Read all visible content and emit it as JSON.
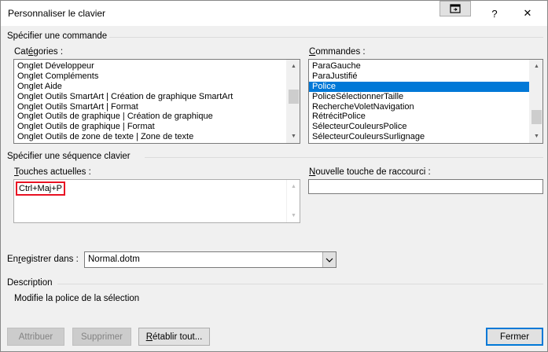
{
  "window": {
    "title": "Personnaliser le clavier",
    "help_symbol": "?",
    "close_symbol": "✕"
  },
  "command_section": {
    "label": "Spécifier une commande",
    "categories": {
      "label_pre": "Cat",
      "label_u": "é",
      "label_post": "gories :",
      "items": [
        "Onglet Développeur",
        "Onglet Compléments",
        "Onglet Aide",
        "Onglet Outils SmartArt | Création de graphique SmartArt",
        "Onglet Outils SmartArt | Format",
        "Onglet Outils de graphique | Création de graphique",
        "Onglet Outils de graphique | Format",
        "Onglet Outils de zone de texte | Zone de texte"
      ]
    },
    "commands": {
      "label_u": "C",
      "label_post": "ommandes :",
      "items": [
        "ParaGauche",
        "ParaJustifié",
        "Police",
        "PoliceSélectionnerTaille",
        "RechercheVoletNavigation",
        "RétrécitPolice",
        "SélecteurCouleursPolice",
        "SélecteurCouleursSurlignage"
      ],
      "selected_index": 2
    }
  },
  "shortcut_section": {
    "label": "Spécifier une séquence clavier",
    "current_keys": {
      "label_u": "T",
      "label_post": "ouches actuelles :",
      "items": [
        "Ctrl+Maj+P"
      ]
    },
    "new_key": {
      "label_u": "N",
      "label_post": "ouvelle touche de raccourci :",
      "value": ""
    }
  },
  "save_in": {
    "label_pre": "En",
    "label_u": "r",
    "label_post": "egistrer dans :",
    "value": "Normal.dotm"
  },
  "description": {
    "label": "Description",
    "text": "Modifie la police de la sélection"
  },
  "buttons": {
    "assign": "Attribuer",
    "remove": "Supprimer",
    "reset_u": "R",
    "reset_post": "établir tout...",
    "close": "Fermer"
  }
}
